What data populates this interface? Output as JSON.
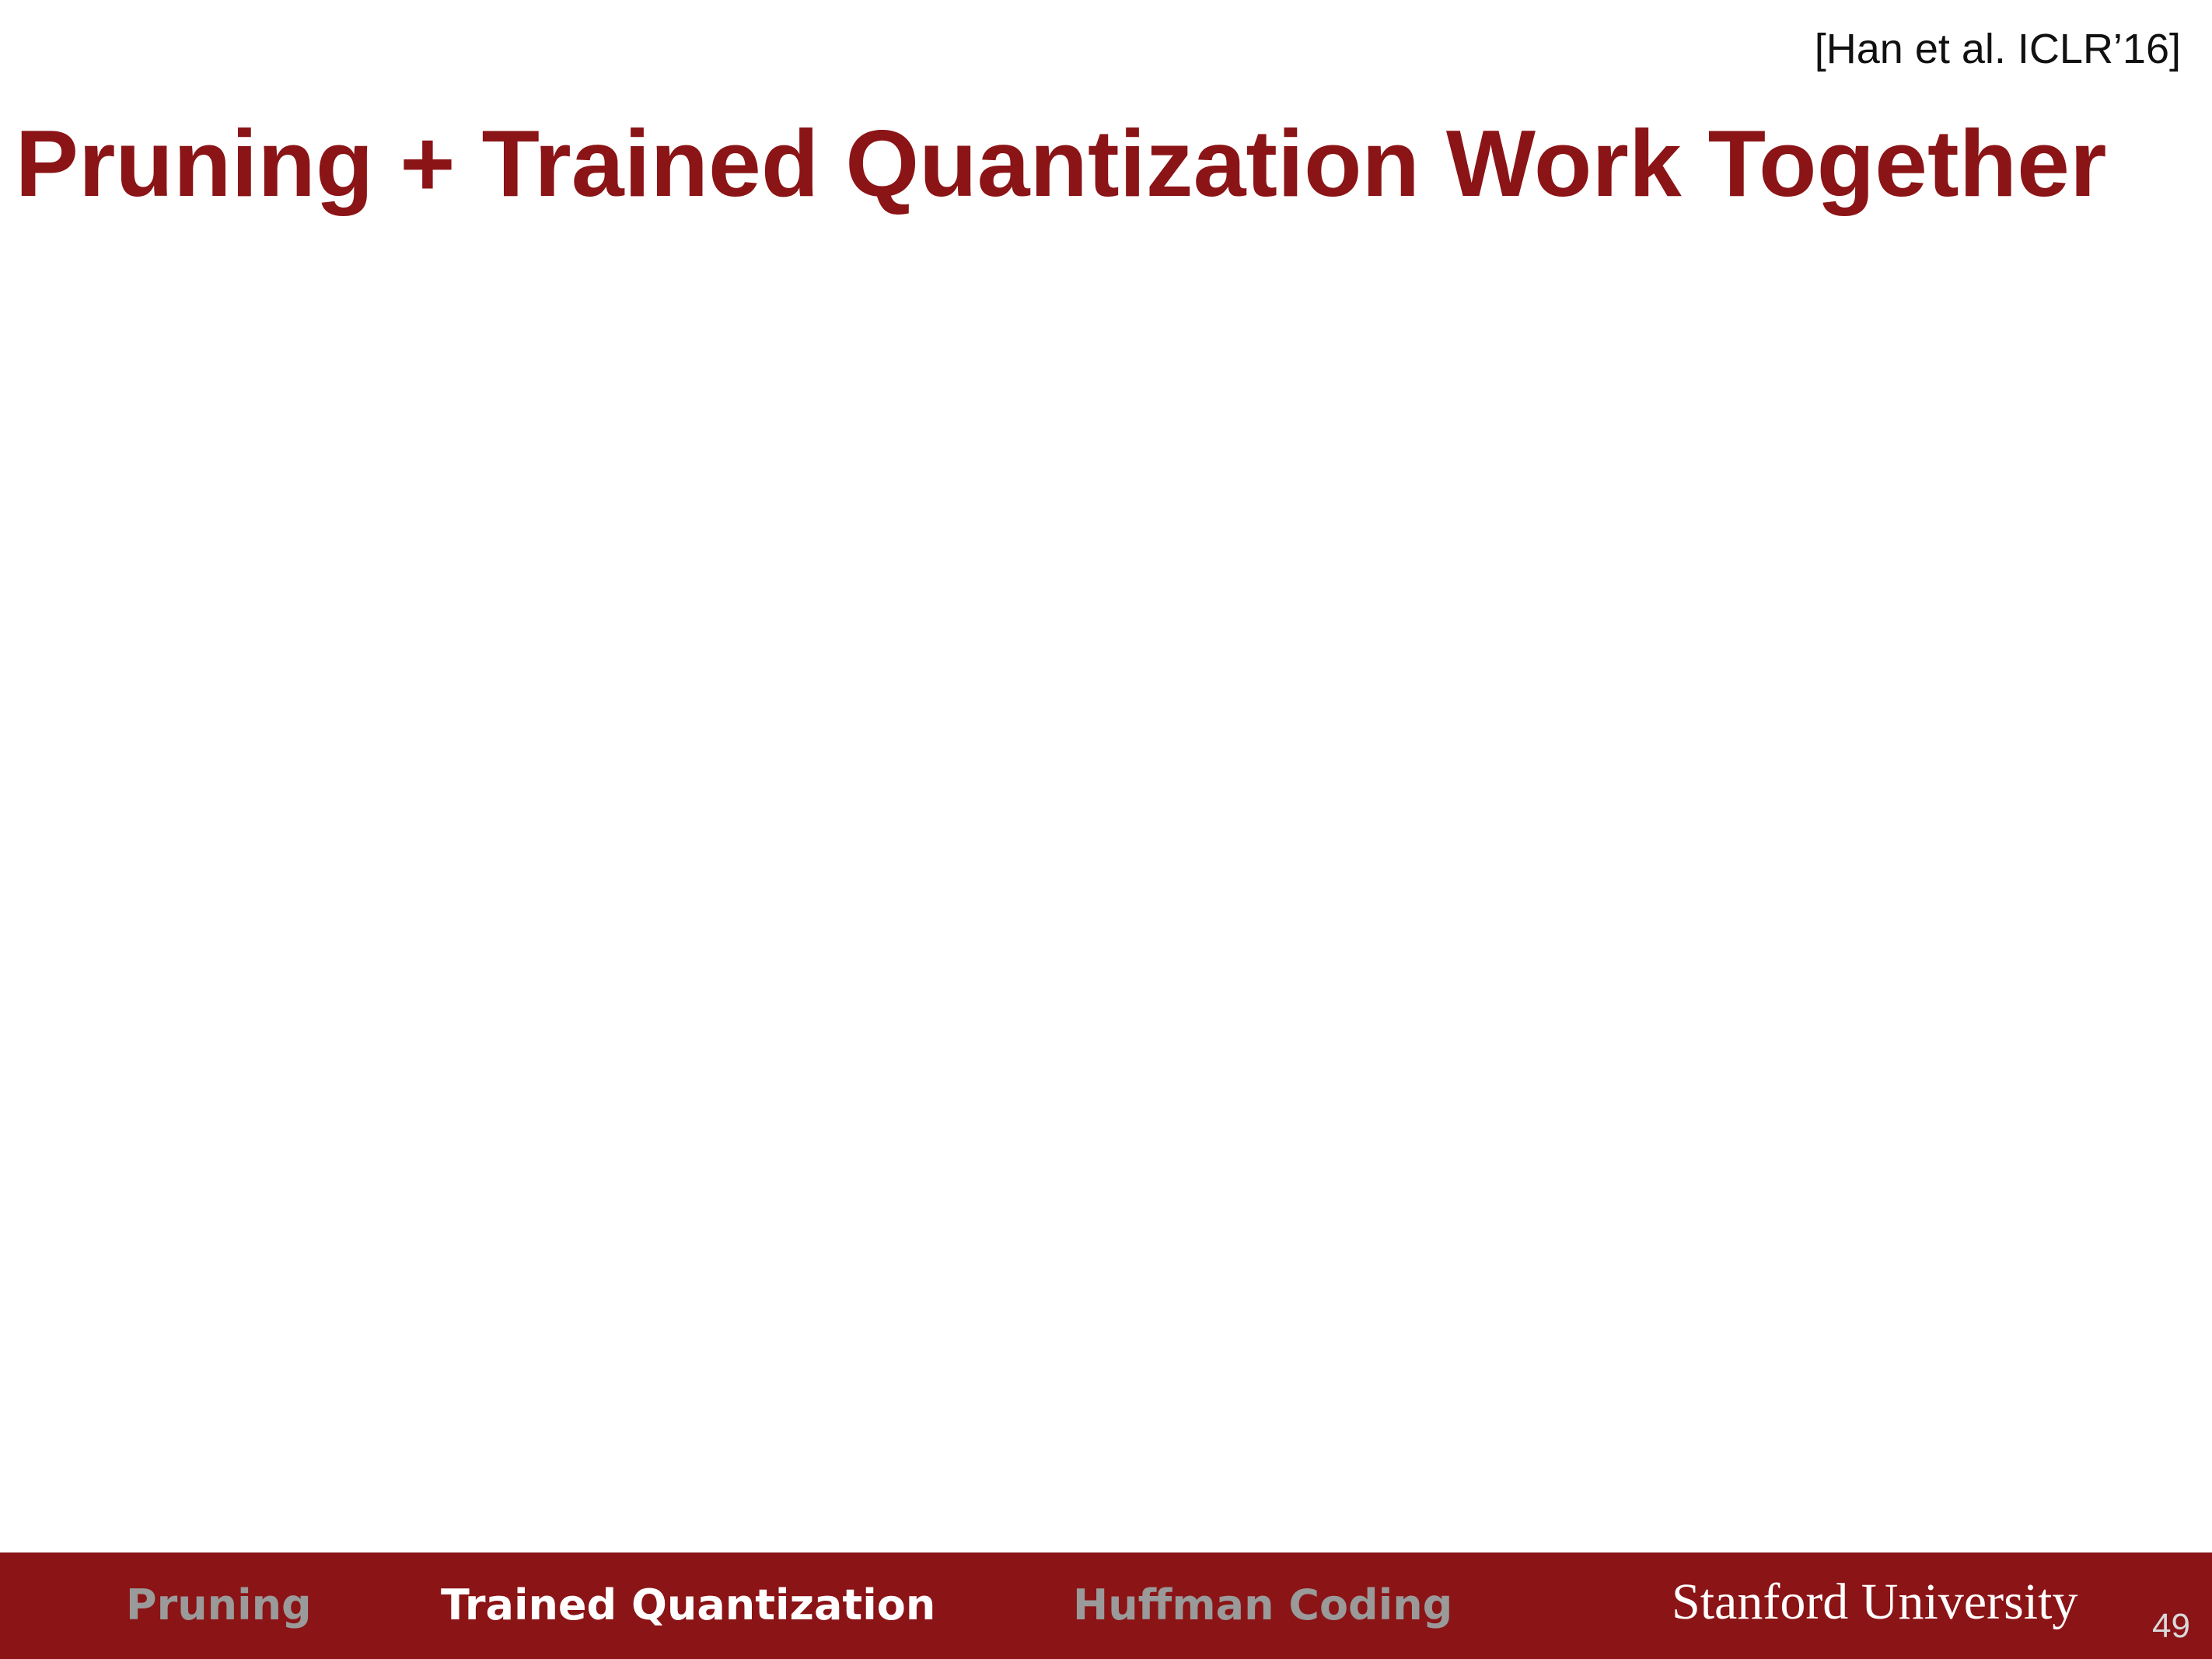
{
  "slide": {
    "citation": "[Han et al. ICLR’16]",
    "title": "Pruning + Trained Quantization Work Together"
  },
  "footer": {
    "nav": {
      "pruning": "Pruning",
      "trained_quantization": "Trained Quantization",
      "huffman_coding": "Huffman Coding"
    },
    "active_item": "Trained Quantization",
    "brand": "Stanford University",
    "page_number": "49"
  },
  "colors": {
    "accent": "#8b1416",
    "inactive_nav": "#9a9a9a",
    "active_nav": "#ffffff"
  }
}
